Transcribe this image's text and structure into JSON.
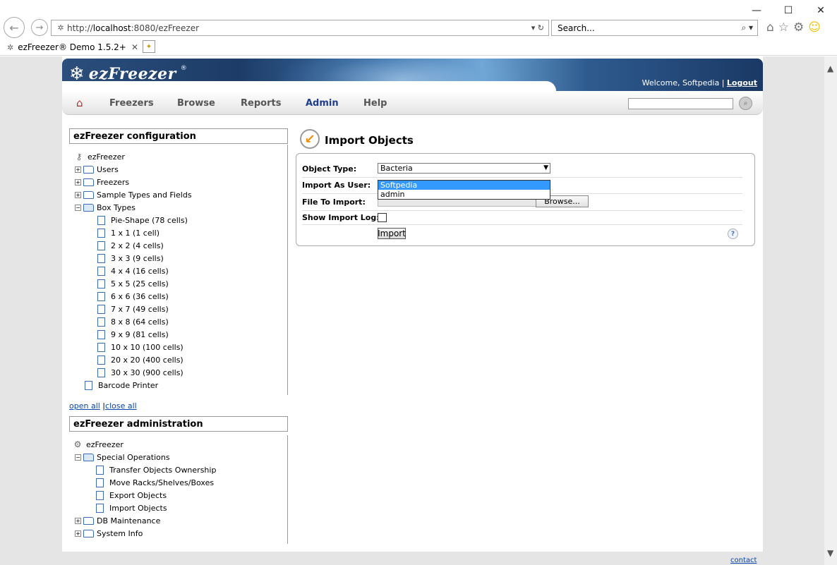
{
  "browser": {
    "address_scheme": "http://",
    "address_host": "localhost",
    "address_rest": ":8080/ezFreezer",
    "search_placeholder": "Search...",
    "tab_title": "ezFreezer® Demo 1.5.2+"
  },
  "header": {
    "logo_text": "ezFreezer",
    "logo_reg": "®",
    "welcome": "Welcome, Softpedia | ",
    "logout": "Logout"
  },
  "nav": {
    "items": [
      "Freezers",
      "Browse",
      "Reports",
      "Admin",
      "Help"
    ],
    "active": "Admin"
  },
  "config_panel": {
    "title": "ezFreezer configuration",
    "root": "ezFreezer",
    "items": [
      "Users",
      "Freezers",
      "Sample Types and Fields",
      "Box Types"
    ],
    "box_types": [
      "Pie-Shape (78 cells)",
      "1 x 1 (1 cell)",
      "2 x 2 (4 cells)",
      "3 x 3 (9 cells)",
      "4 x 4 (16 cells)",
      "5 x 5 (25 cells)",
      "6 x 6 (36 cells)",
      "7 x 7 (49 cells)",
      "8 x 8 (64 cells)",
      "9 x 9 (81 cells)",
      "10 x 10 (100 cells)",
      "20 x 20 (400 cells)",
      "30 x 30 (900 cells)"
    ],
    "last_item": "Barcode Printer",
    "open_all": "open all",
    "separator": " |",
    "close_all": "close all"
  },
  "admin_panel": {
    "title": "ezFreezer administration",
    "root": "ezFreezer",
    "special_ops": "Special Operations",
    "ops": [
      "Transfer Objects Ownership",
      "Move Racks/Shelves/Boxes",
      "Export Objects",
      "Import Objects"
    ],
    "db_maintenance": "DB Maintenance",
    "system_info": "System Info"
  },
  "import_form": {
    "title": "Import Objects",
    "object_type_label": "Object Type:",
    "object_type_value": "Bacteria",
    "import_as_label": "Import As User:",
    "user_options": [
      "Softpedia",
      "admin"
    ],
    "selected_user": "Softpedia",
    "file_label": "File To Import:",
    "browse": "Browse...",
    "log_label": "Show Import Log:",
    "import_button": "Import",
    "help": "?"
  },
  "footer": {
    "contact": "contact us"
  }
}
